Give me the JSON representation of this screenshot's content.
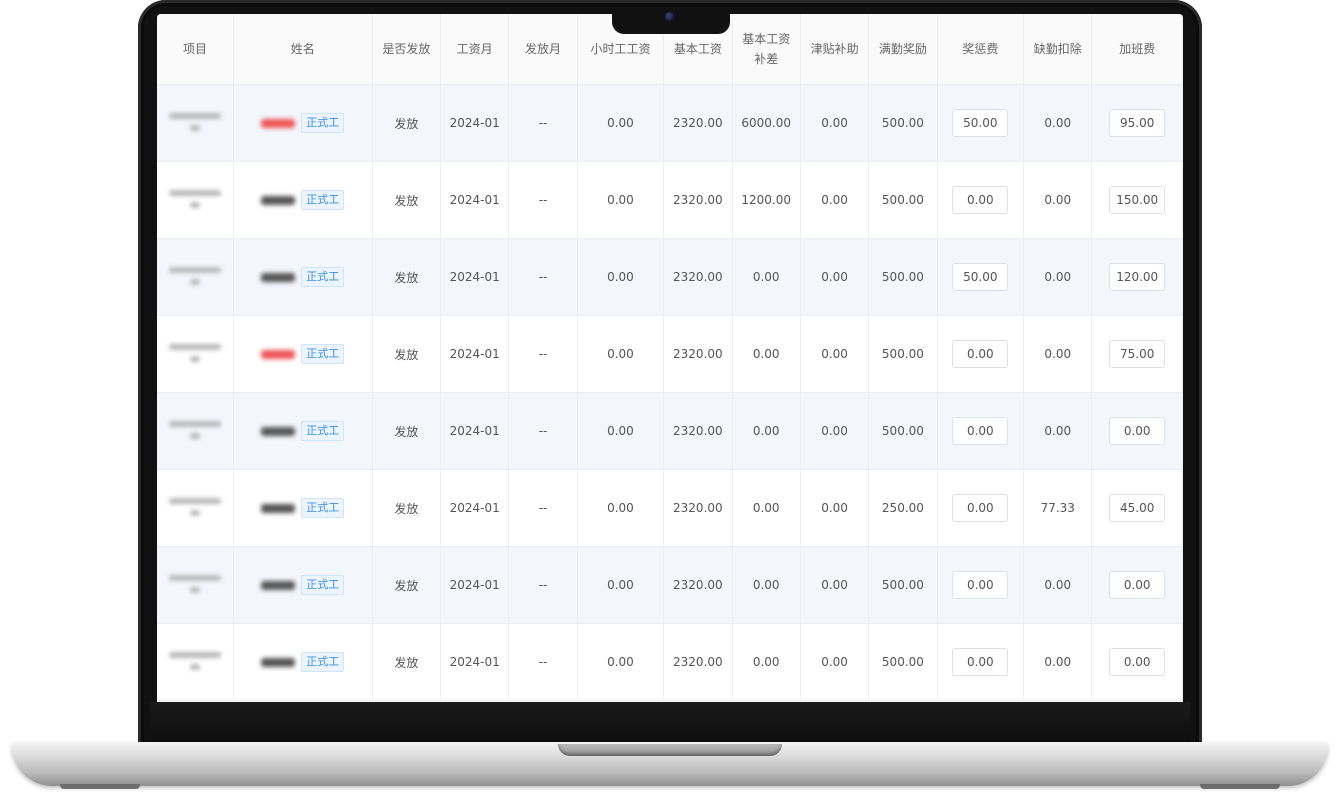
{
  "headers": {
    "project": "项目",
    "name": "姓名",
    "issued": "是否发放",
    "pay_month": "工资月",
    "issue_month": "发放月",
    "hourly": "小时工工资",
    "base": "基本工资",
    "base_diff_l1": "基本工资",
    "base_diff_l2": "补差",
    "allowance": "津贴补助",
    "attendance": "满勤奖励",
    "bonus": "奖惩费",
    "deduction": "缺勤扣除",
    "overtime": "加班费"
  },
  "rows": [
    {
      "tag": "正式工",
      "issued": "发放",
      "pay_month": "2024-01",
      "issue_month": "--",
      "hourly": "0.00",
      "base": "2320.00",
      "base_diff": "6000.00",
      "allowance": "0.00",
      "attendance": "500.00",
      "bonus": "50.00",
      "deduction": "0.00",
      "overtime": "95.00"
    },
    {
      "tag": "正式工",
      "issued": "发放",
      "pay_month": "2024-01",
      "issue_month": "--",
      "hourly": "0.00",
      "base": "2320.00",
      "base_diff": "1200.00",
      "allowance": "0.00",
      "attendance": "500.00",
      "bonus": "0.00",
      "deduction": "0.00",
      "overtime": "150.00"
    },
    {
      "tag": "正式工",
      "issued": "发放",
      "pay_month": "2024-01",
      "issue_month": "--",
      "hourly": "0.00",
      "base": "2320.00",
      "base_diff": "0.00",
      "allowance": "0.00",
      "attendance": "500.00",
      "bonus": "50.00",
      "deduction": "0.00",
      "overtime": "120.00"
    },
    {
      "tag": "正式工",
      "issued": "发放",
      "pay_month": "2024-01",
      "issue_month": "--",
      "hourly": "0.00",
      "base": "2320.00",
      "base_diff": "0.00",
      "allowance": "0.00",
      "attendance": "500.00",
      "bonus": "0.00",
      "deduction": "0.00",
      "overtime": "75.00"
    },
    {
      "tag": "正式工",
      "issued": "发放",
      "pay_month": "2024-01",
      "issue_month": "--",
      "hourly": "0.00",
      "base": "2320.00",
      "base_diff": "0.00",
      "allowance": "0.00",
      "attendance": "500.00",
      "bonus": "0.00",
      "deduction": "0.00",
      "overtime": "0.00"
    },
    {
      "tag": "正式工",
      "issued": "发放",
      "pay_month": "2024-01",
      "issue_month": "--",
      "hourly": "0.00",
      "base": "2320.00",
      "base_diff": "0.00",
      "allowance": "0.00",
      "attendance": "250.00",
      "bonus": "0.00",
      "deduction": "77.33",
      "overtime": "45.00"
    },
    {
      "tag": "正式工",
      "issued": "发放",
      "pay_month": "2024-01",
      "issue_month": "--",
      "hourly": "0.00",
      "base": "2320.00",
      "base_diff": "0.00",
      "allowance": "0.00",
      "attendance": "500.00",
      "bonus": "0.00",
      "deduction": "0.00",
      "overtime": "0.00"
    },
    {
      "tag": "正式工",
      "issued": "发放",
      "pay_month": "2024-01",
      "issue_month": "--",
      "hourly": "0.00",
      "base": "2320.00",
      "base_diff": "0.00",
      "allowance": "0.00",
      "attendance": "500.00",
      "bonus": "0.00",
      "deduction": "0.00",
      "overtime": "0.00"
    }
  ],
  "colors": {
    "tag_text": "#3a8ee6",
    "tag_bg": "#ecf5ff",
    "row_stripe": "#f3f6fb",
    "name_red": "#e55555"
  },
  "icons": {
    "camera": "camera-icon"
  }
}
